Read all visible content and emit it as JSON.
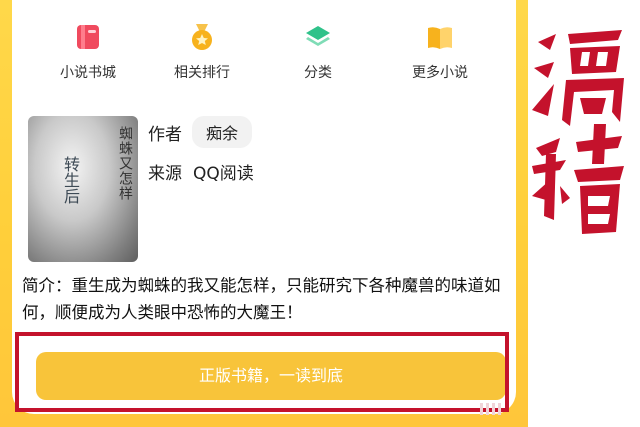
{
  "nav": {
    "items": [
      {
        "label": "小说书城",
        "icon": "book-icon",
        "color": "#f04a5e"
      },
      {
        "label": "相关排行",
        "icon": "medal-icon",
        "color": "#f7b21d"
      },
      {
        "label": "分类",
        "icon": "layers-icon",
        "color": "#2fc28a"
      },
      {
        "label": "更多小说",
        "icon": "open-book-icon",
        "color": "#f7b21d"
      }
    ]
  },
  "book": {
    "cover_title": "蜘蛛又怎样",
    "cover_subtitle": "转生后",
    "author_label": "作者",
    "author": "痴余",
    "source_label": "来源",
    "source": "QQ阅读",
    "intro": "简介：重生成为蜘蛛的我又能怎样，只能研究下各种魔兽的味道如何，顺便成为人类眼中恐怖的大魔王！"
  },
  "cta": {
    "label": "正版书籍，一读到底",
    "color": "#f8c43a"
  },
  "overlay": {
    "calligraphy": "滑稽",
    "color": "#c4122c"
  },
  "theme": {
    "frame": "#ffd24a"
  }
}
